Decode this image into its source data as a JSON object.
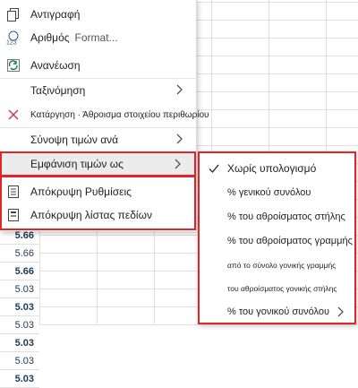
{
  "sheet": {
    "cells": [
      {
        "value": "5.66",
        "bold": true
      },
      {
        "value": "5.66",
        "bold": false
      },
      {
        "value": "5.66",
        "bold": true
      },
      {
        "value": "5.03",
        "bold": false
      },
      {
        "value": "5.03",
        "bold": true
      },
      {
        "value": "5.03",
        "bold": false
      },
      {
        "value": "5.03",
        "bold": true
      },
      {
        "value": "5.03",
        "bold": false
      },
      {
        "value": "5.03",
        "bold": true
      }
    ]
  },
  "menu": {
    "copy": "Αντιγραφή",
    "number_format": "Αριθμός",
    "number_format_shortcut": "Format...",
    "refresh": "Ανανέωση",
    "sort": "Ταξινόμηση",
    "remove_subtotal": "Κατάργηση · Άθροισμα στοιχείου περιθωρίου",
    "summarize_by": "Σύνοψη τιμών ανά",
    "show_values_as": "Εμφάνιση τιμών ως",
    "hide_settings": "Απόκρυψη Ρυθμίσεις",
    "hide_field_list": "Απόκρυψη λίστας πεδίων"
  },
  "submenu": {
    "no_calculation": "Χωρίς υπολογισμό",
    "pct_grand_total": "% γενικού συνόλου",
    "pct_column_total": "% του αθροίσματος στήλης",
    "pct_row_total": "% του αθροίσματος γραμμής",
    "pct_parent_total_row": "από το σύνολο γονικής γραμμής",
    "pct_parent_total_col": "του αθροίσματος γονικής στήλης",
    "pct_parent_total": "% του γονικού συνόλου"
  },
  "colors": {
    "highlight_border": "#e0262b",
    "icon_blue": "#2b579a",
    "icon_green": "#107c41",
    "icon_red": "#d13438"
  }
}
